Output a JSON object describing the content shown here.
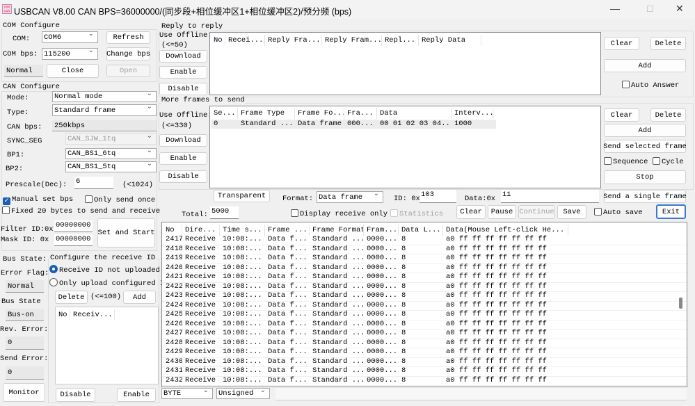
{
  "window": {
    "title": "USBCAN V8.00   CAN BPS=36000000/(同步段+相位缓冲区1+相位缓冲区2)/预分频 (bps)",
    "logo_text": "USB CAN",
    "minimize": "—",
    "maximize": "□",
    "close": "✕"
  },
  "com": {
    "group": "COM Configure",
    "com_label": "COM:",
    "com_value": "COM6",
    "bps_label": "COM bps:",
    "bps_value": "115200",
    "refresh": "Refresh",
    "change_bps": "Change bps",
    "status": "Normal",
    "close": "Close",
    "open": "Open"
  },
  "can": {
    "group": "CAN Configure",
    "mode_label": "Mode:",
    "mode_value": "Normal mode",
    "type_label": "Type:",
    "type_value": "Standard frame",
    "bps_label": "CAN bps:",
    "bps_value": "250kbps",
    "sync_label": "SYNC_SEG",
    "sync_value": "CAN_SJW_1tq",
    "bp1_label": "BP1:",
    "bp1_value": "CAN_BS1_6tq",
    "bp2_label": "BP2:",
    "bp2_value": "CAN_BS1_5tq",
    "prescale_label": "Prescale(Dec):",
    "prescale_value": "6",
    "prescale_hint": "(<1024)",
    "manual_bps": "Manual set bps",
    "manual_bps_checked": true,
    "only_send_once": "Only send once",
    "fixed20": "Fixed 20 bytes to send and receive",
    "filter_label": "Filter ID:0x",
    "filter_value": "00000000",
    "mask_label": "Mask ID:  0x",
    "mask_value": "00000000",
    "set_start": "Set and Start"
  },
  "status": {
    "bus_state_label": "Bus State:",
    "error_flag_label": "Error Flag:",
    "error_flag": "Normal",
    "bus_state2_label": "Bus State",
    "bus_state": "Bus-on",
    "rev_error_label": "Rev. Error:",
    "rev_error": "0",
    "send_error_label": "Send Error:",
    "send_error": "0",
    "monitor": "Monitor"
  },
  "recv_id": {
    "group": "Configure the receive ID",
    "opt1": "Receive ID not uploaded",
    "opt2": "Only upload configured ID",
    "delete": "Delete",
    "limit": "(<=100)",
    "add": "Add",
    "cols": [
      "No",
      "Receiv..."
    ],
    "disable": "Disable",
    "enable": "Enable"
  },
  "reply": {
    "group": "Reply to reply",
    "offline": "Use Offline:",
    "limit": "(<=50)",
    "download": "Download",
    "enable": "Enable",
    "disable": "Disable",
    "cols": [
      "No",
      "Recei...",
      "Reply Fra...",
      "Reply Fram...",
      "Repl...",
      "Reply Data"
    ],
    "clear": "Clear",
    "delete": "Delete",
    "add": "Add",
    "auto_answer": "Auto Answer"
  },
  "multi": {
    "group": "More frames to send",
    "offline": "Use Offline:",
    "limit": "(<=330)",
    "download": "Download",
    "enable": "Enable",
    "disable": "Disable",
    "cols": [
      "Se...",
      "Frame Type",
      "Frame Fo...",
      "Fra...",
      "Data",
      "Interv..."
    ],
    "rows": [
      [
        "0",
        "Standard ...",
        "Data frame",
        "000...",
        "00 01 02 03 04...",
        "1000"
      ]
    ],
    "clear": "Clear",
    "delete": "Delete",
    "add": "Add",
    "send_selected": "Send selected frame",
    "sequence": "Sequence",
    "cycle": "Cycle",
    "stop": "Stop"
  },
  "send": {
    "transparent": "Transparent",
    "format_label": "Format:",
    "format_value": "Data frame",
    "id_label": "ID: 0x",
    "id_value": "103",
    "data_label": "Data:0x",
    "data_value": "11",
    "send_single": "Send a single frame",
    "total_label": "Total:",
    "total_value": "5000",
    "display_recv": "Display receive only",
    "statistics": "Statistics",
    "clear": "Clear",
    "pause": "Pause",
    "continue": "Continue",
    "save": "Save",
    "auto_save": "Auto save",
    "exit": "Exit"
  },
  "log": {
    "cols": [
      "No",
      "Dire...",
      "Time s...",
      "Frame ...",
      "Frame Format",
      "Fram...",
      "Data L...",
      "Data(Mouse Left-click He..."
    ],
    "rows": [
      [
        "2417",
        "Receive",
        "10:08:...",
        "Data f...",
        "Standard ...",
        "0000...",
        "8",
        "a0 ff ff ff ff ff ff ff"
      ],
      [
        "2418",
        "Receive",
        "10:08:...",
        "Data f...",
        "Standard ...",
        "0000...",
        "8",
        "a0 ff ff ff ff ff ff ff"
      ],
      [
        "2419",
        "Receive",
        "10:08:...",
        "Data f...",
        "Standard ...",
        "0000...",
        "8",
        "a0 ff ff ff ff ff ff ff"
      ],
      [
        "2420",
        "Receive",
        "10:08:...",
        "Data f...",
        "Standard ...",
        "0000...",
        "8",
        "a0 ff ff ff ff ff ff ff"
      ],
      [
        "2421",
        "Receive",
        "10:08:...",
        "Data f...",
        "Standard ...",
        "0000...",
        "8",
        "a0 ff ff ff ff ff ff ff"
      ],
      [
        "2422",
        "Receive",
        "10:08:...",
        "Data f...",
        "Standard ...",
        "0000...",
        "8",
        "a0 ff ff ff ff ff ff ff"
      ],
      [
        "2423",
        "Receive",
        "10:08:...",
        "Data f...",
        "Standard ...",
        "0000...",
        "8",
        "a0 ff ff ff ff ff ff ff"
      ],
      [
        "2424",
        "Receive",
        "10:08:...",
        "Data f...",
        "Standard ...",
        "0000...",
        "8",
        "a0 ff ff ff ff ff ff ff"
      ],
      [
        "2425",
        "Receive",
        "10:08:...",
        "Data f...",
        "Standard ...",
        "0000...",
        "8",
        "a0 ff ff ff ff ff ff ff"
      ],
      [
        "2426",
        "Receive",
        "10:08:...",
        "Data f...",
        "Standard ...",
        "0000...",
        "8",
        "a0 ff ff ff ff ff ff ff"
      ],
      [
        "2427",
        "Receive",
        "10:08:...",
        "Data f...",
        "Standard ...",
        "0000...",
        "8",
        "a0 ff ff ff ff ff ff ff"
      ],
      [
        "2428",
        "Receive",
        "10:08:...",
        "Data f...",
        "Standard ...",
        "0000...",
        "8",
        "a0 ff ff ff ff ff ff ff"
      ],
      [
        "2429",
        "Receive",
        "10:08:...",
        "Data f...",
        "Standard ...",
        "0000...",
        "8",
        "a0 ff ff ff ff ff ff ff"
      ],
      [
        "2430",
        "Receive",
        "10:08:...",
        "Data f...",
        "Standard ...",
        "0000...",
        "8",
        "a0 ff ff ff ff ff ff ff"
      ],
      [
        "2431",
        "Receive",
        "10:08:...",
        "Data f...",
        "Standard ...",
        "0000...",
        "8",
        "a0 ff ff ff ff ff ff ff"
      ],
      [
        "2432",
        "Receive",
        "10:08:...",
        "Data f...",
        "Standard ...",
        "0000...",
        "8",
        "a0 ff ff ff ff ff ff ff"
      ]
    ],
    "display_type": "BYTE",
    "sign": "Unsigned"
  }
}
